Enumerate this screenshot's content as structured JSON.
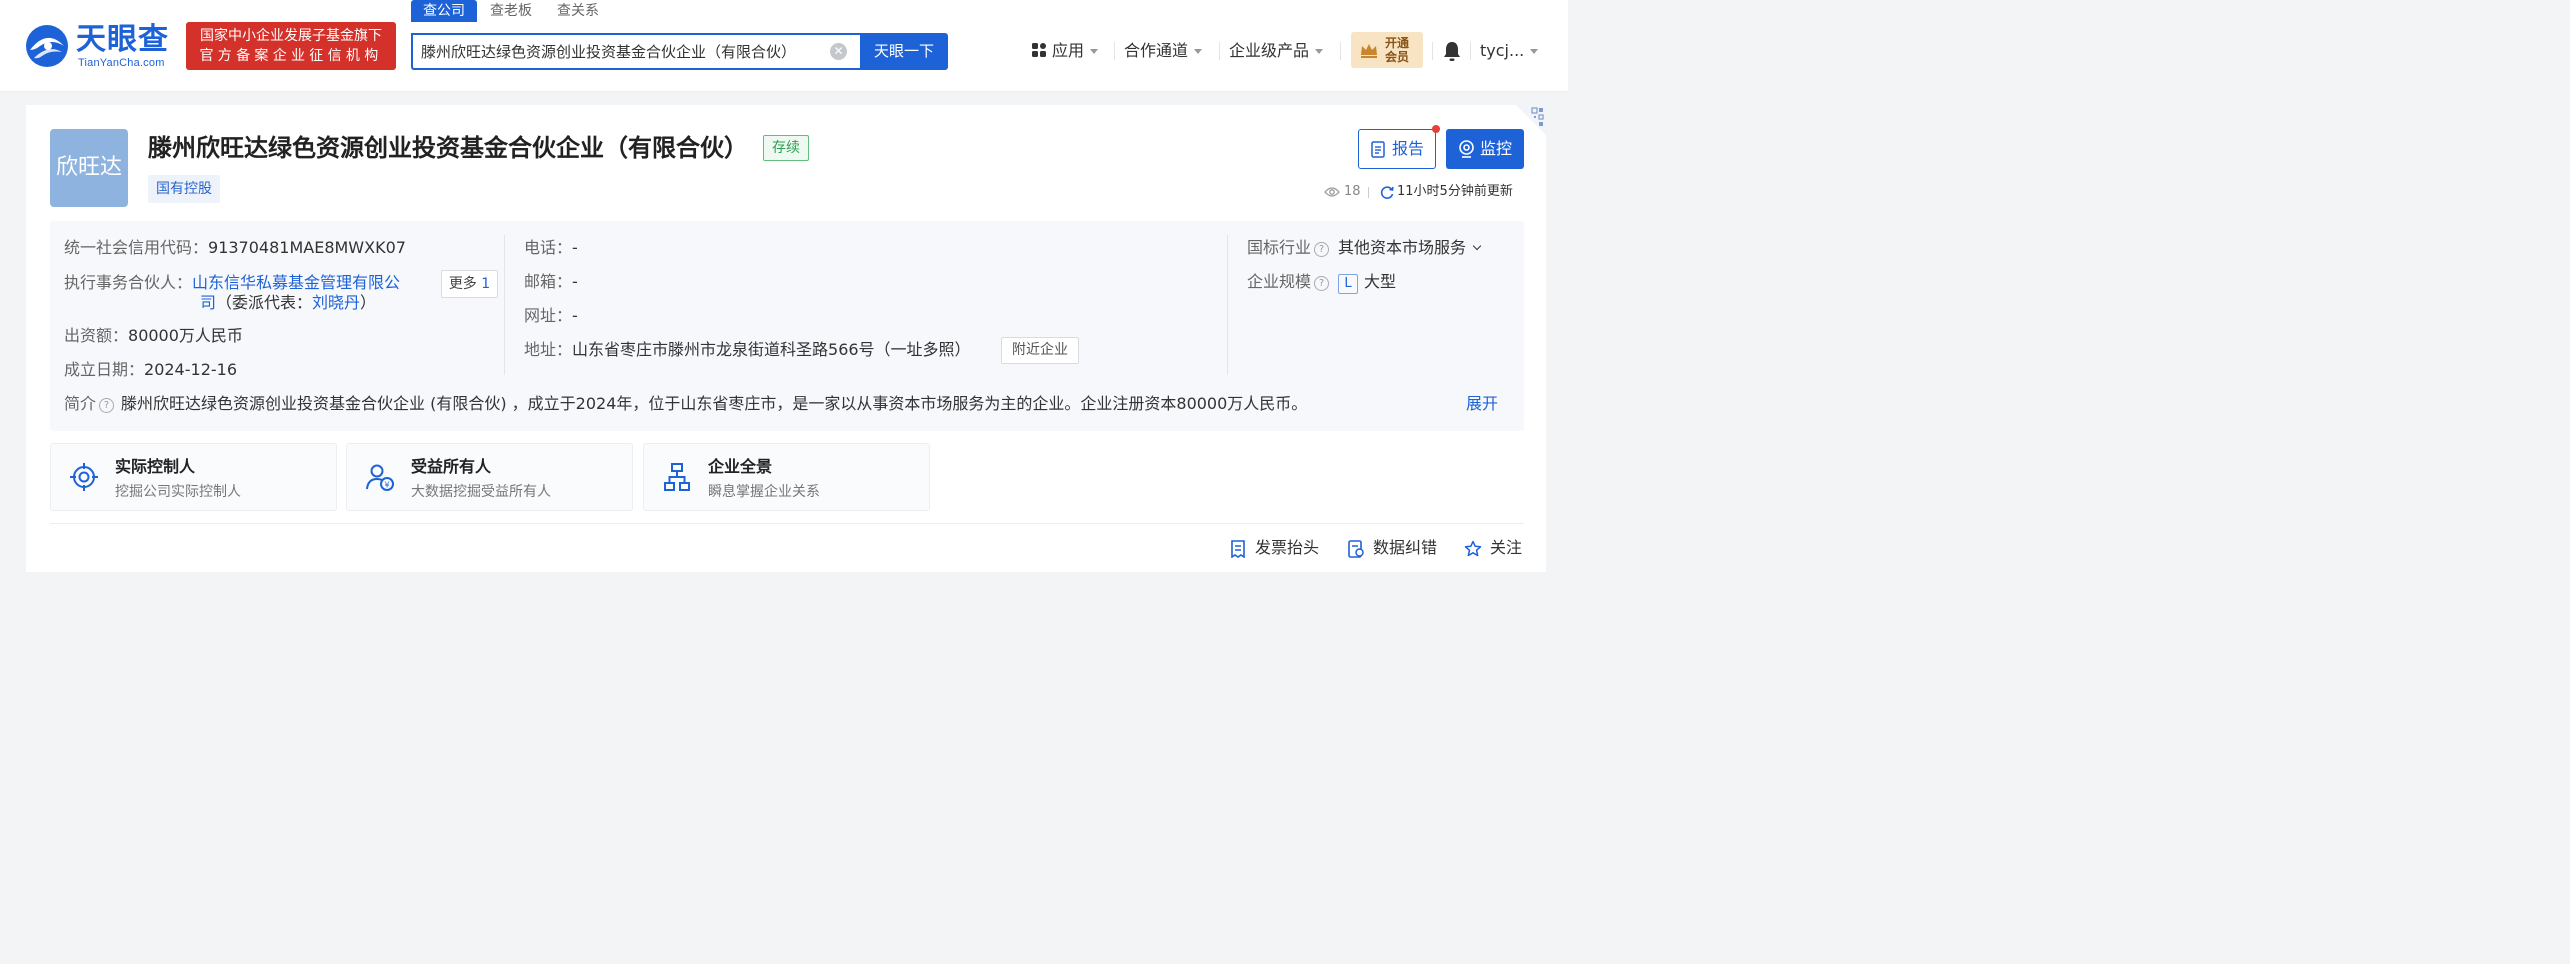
{
  "header": {
    "logo_cn": "天眼查",
    "logo_en": "TianYanCha.com",
    "gov_badge_line1": "国家中小企业发展子基金旗下",
    "gov_badge_line2": "官方备案企业征信机构",
    "search_tabs": [
      "查公司",
      "查老板",
      "查关系"
    ],
    "search_value": "滕州欣旺达绿色资源创业投资基金合伙企业（有限合伙）",
    "search_button": "天眼一下",
    "nav": [
      "应用",
      "合作通道",
      "企业级产品"
    ],
    "vip_line1": "开通",
    "vip_line2": "会员",
    "user": "tycj..."
  },
  "company": {
    "avatar_text": "欣旺达",
    "name": "滕州欣旺达绿色资源创业投资基金合伙企业（有限合伙）",
    "status": "存续",
    "ownership_tag": "国有控股",
    "report_label": "报告",
    "monitor_label": "监控",
    "views": "18",
    "updated": "11小时5分钟前更新"
  },
  "info": {
    "credit_code_label": "统一社会信用代码：",
    "credit_code": "91370481MAE8MWXK07",
    "partner_label": "执行事务合伙人：",
    "partner_line1": "山东信华私募基金管理有限公",
    "partner_line2": "司",
    "partner_rep_prefix": "（委派代表：",
    "partner_rep": "刘晓丹",
    "partner_rep_suffix": "）",
    "more_label": "更多",
    "more_count": "1",
    "capital_label": "出资额：",
    "capital": "80000万人民币",
    "founded_label": "成立日期：",
    "founded": "2024-12-16",
    "phone_label": "电话：",
    "phone": "-",
    "email_label": "邮箱：",
    "email": "-",
    "website_label": "网址：",
    "website": "-",
    "address_label": "地址：",
    "address": "山东省枣庄市滕州市龙泉街道科圣路566号（一址多照）",
    "nearby": "附近企业",
    "industry_label": "国标行业",
    "industry": "其他资本市场服务",
    "scale_label": "企业规模",
    "scale_badge": "L",
    "scale": "大型",
    "intro_label": "简介",
    "intro": "滕州欣旺达绿色资源创业投资基金合伙企业 (有限合伙) ，成立于2024年，位于山东省枣庄市，是一家以从事资本市场服务为主的企业。企业注册资本80000万人民币。",
    "expand": "展开"
  },
  "features": [
    {
      "title": "实际控制人",
      "sub": "挖掘公司实际控制人",
      "icon": "target-icon"
    },
    {
      "title": "受益所有人",
      "sub": "大数据挖掘受益所有人",
      "icon": "beneficiary-icon"
    },
    {
      "title": "企业全景",
      "sub": "瞬息掌握企业关系",
      "icon": "org-chart-icon"
    }
  ],
  "actions": [
    "发票抬头",
    "数据纠错",
    "关注"
  ],
  "colors": {
    "brand": "#1e62d8",
    "gov_red": "#d3312a",
    "status_green": "#2f9e55",
    "vip_gold": "#f8e4c2"
  }
}
